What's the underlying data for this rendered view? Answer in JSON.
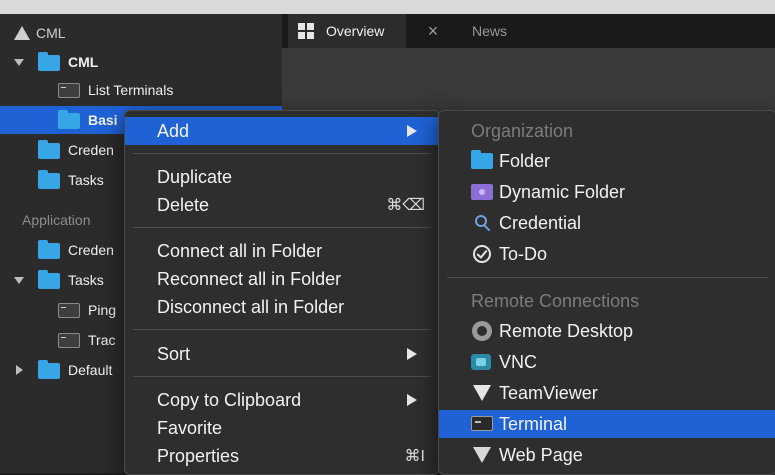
{
  "tabs": {
    "overview_label": "Overview",
    "close_glyph": "×",
    "news_label": "News"
  },
  "sidebar": {
    "header": "CML",
    "tree": {
      "root_folder": "CML",
      "list_terminals": "List Terminals",
      "basic_selected": "Basi",
      "credentials_1": "Creden",
      "tasks_1": "Tasks",
      "application_section": "Application",
      "credentials_2": "Creden",
      "tasks_2": "Tasks",
      "ping": "Ping",
      "trace": "Trac",
      "default": "Default"
    }
  },
  "context_menu": {
    "add": "Add",
    "duplicate": "Duplicate",
    "delete": "Delete",
    "delete_shortcut": "⌘⌫",
    "connect_all": "Connect all in Folder",
    "reconnect_all": "Reconnect all in Folder",
    "disconnect_all": "Disconnect all in Folder",
    "sort": "Sort",
    "copy_clipboard": "Copy to Clipboard",
    "favorite": "Favorite",
    "properties": "Properties",
    "properties_shortcut": "⌘I"
  },
  "add_submenu": {
    "organization_header": "Organization",
    "folder": "Folder",
    "dynamic_folder": "Dynamic Folder",
    "credential": "Credential",
    "todo": "To-Do",
    "remote_header": "Remote Connections",
    "remote_desktop": "Remote Desktop",
    "vnc": "VNC",
    "teamviewer": "TeamViewer",
    "terminal": "Terminal",
    "web_page": "Web Page"
  },
  "colors": {
    "selection": "#1f62d6",
    "folder": "#37a6e6",
    "menu_bg": "#2e2e2e"
  }
}
